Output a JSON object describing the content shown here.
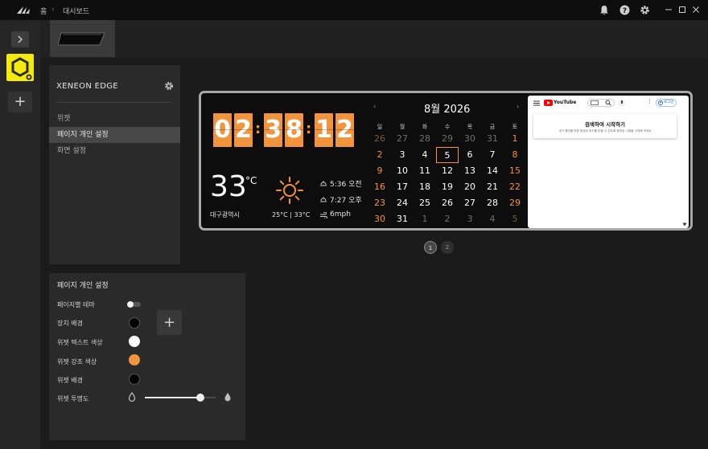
{
  "breadcrumb": {
    "home": "홈",
    "dashboard": "대시보드"
  },
  "titlebar_icons": [
    "bell-icon",
    "help-icon",
    "gear-icon",
    "minimize-icon",
    "maximize-icon",
    "close-icon"
  ],
  "device": {
    "name": "XENEON EDGE"
  },
  "menu": {
    "items": [
      "위젯",
      "페이지 개인 설정",
      "화면 설정"
    ],
    "active_index": 1
  },
  "personalization": {
    "title": "페이지 개인 설정",
    "rows": {
      "page_theme": "페이지별 테마",
      "device_bg": "장치 배경",
      "widget_text_color": "위젯 텍스트 색상",
      "widget_accent_color": "위젯 강조 색상",
      "widget_bg": "위젯 배경",
      "widget_opacity": "위젯 투명도"
    },
    "opacity_value_percent": 78,
    "colors": {
      "device_bg": "#000000",
      "widget_text": "#ffffff",
      "widget_accent": "#f2943b",
      "widget_bg": "#000000"
    }
  },
  "clock": {
    "digits": [
      "0",
      "2",
      "3",
      "8",
      "1",
      "2"
    ]
  },
  "weather": {
    "temp": "33",
    "unit": "°C",
    "location": "대구광역시",
    "range": "25°C | 33°C",
    "sunrise": "5:36 오전",
    "sunset": "7:27 오후",
    "wind": "6mph"
  },
  "calendar": {
    "title": "8월 2026",
    "weekdays": [
      "일",
      "월",
      "화",
      "수",
      "목",
      "금",
      "토"
    ],
    "weeks": [
      [
        "26",
        "27",
        "28",
        "29",
        "30",
        "31",
        "1"
      ],
      [
        "2",
        "3",
        "4",
        "5",
        "6",
        "7",
        "8"
      ],
      [
        "9",
        "10",
        "11",
        "12",
        "13",
        "14",
        "15"
      ],
      [
        "16",
        "17",
        "18",
        "19",
        "20",
        "21",
        "22"
      ],
      [
        "23",
        "24",
        "25",
        "26",
        "27",
        "28",
        "29"
      ],
      [
        "30",
        "31",
        "1",
        "2",
        "3",
        "4",
        "5"
      ]
    ],
    "today": "5"
  },
  "youtube": {
    "logo": "YouTube",
    "login": "로그인",
    "card_title": "검색하여 시작하기",
    "card_text": "내가 좋아할 만한 동영상 피드를 받을 수 있도록 동영상 시청을 시작해 보세요"
  },
  "pager": {
    "pages": [
      "1",
      "2"
    ],
    "active": "1"
  },
  "accent_color": "#f2943b"
}
